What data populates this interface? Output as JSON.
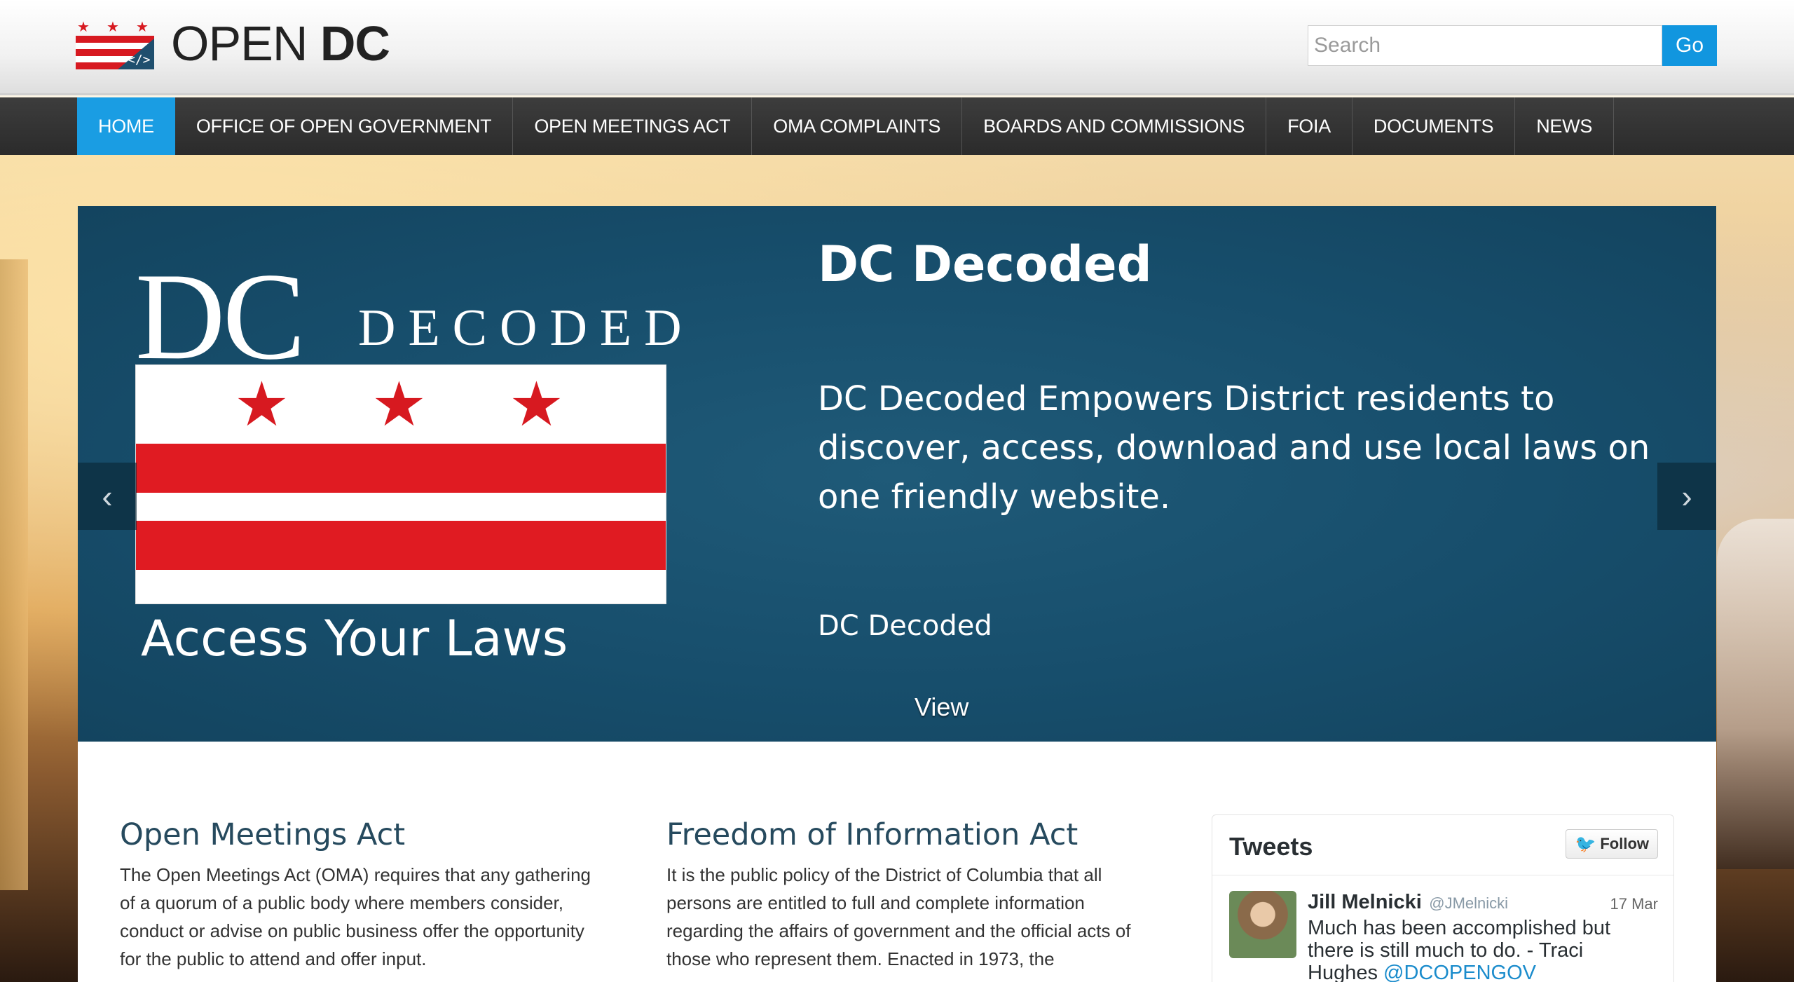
{
  "brand": {
    "word1": "OPEN",
    "word2": "DC",
    "logo_icon": "dc-flag-code-icon"
  },
  "search": {
    "placeholder": "Search",
    "button": "Go"
  },
  "nav": {
    "items": [
      {
        "label": "HOME",
        "active": true
      },
      {
        "label": "OFFICE OF OPEN GOVERNMENT"
      },
      {
        "label": "OPEN MEETINGS ACT"
      },
      {
        "label": "OMA COMPLAINTS"
      },
      {
        "label": "BOARDS AND COMMISSIONS"
      },
      {
        "label": "FOIA"
      },
      {
        "label": "DOCUMENTS"
      },
      {
        "label": "NEWS"
      }
    ]
  },
  "hero": {
    "logo_dc": "DC",
    "logo_decoded": "DECODED",
    "tagline": "Access Your Laws",
    "title": "DC Decoded",
    "description": "DC Decoded Empowers District residents to discover, access, download and use local laws on one friendly website.",
    "subtitle": "DC Decoded",
    "view": "View",
    "prev_icon": "chevron-left-icon",
    "next_icon": "chevron-right-icon"
  },
  "sections": [
    {
      "title": "Open Meetings Act",
      "body": "The Open Meetings Act (OMA) requires that any gathering of a quorum of a public body where members consider, conduct or advise on public business offer the opportunity for the public to attend and offer input."
    },
    {
      "title": "Freedom of Information Act",
      "body": "It is the public policy of the District of Columbia that all persons are entitled to full and complete information regarding the affairs of government and the official acts of those who represent them. Enacted in 1973, the"
    }
  ],
  "tweets": {
    "title": "Tweets",
    "follow": "Follow",
    "items": [
      {
        "name": "Jill Melnicki",
        "handle": "@JMelnicki",
        "date": "17 Mar",
        "text": "Much has been accomplished but there is still much to do. - Traci Hughes",
        "mention": "@DCOPENGOV"
      }
    ]
  },
  "colors": {
    "accent": "#1a9de3",
    "hero_bg": "#174e6c",
    "nav_bg": "#2b2b2b",
    "flag_red": "#e01b22"
  }
}
